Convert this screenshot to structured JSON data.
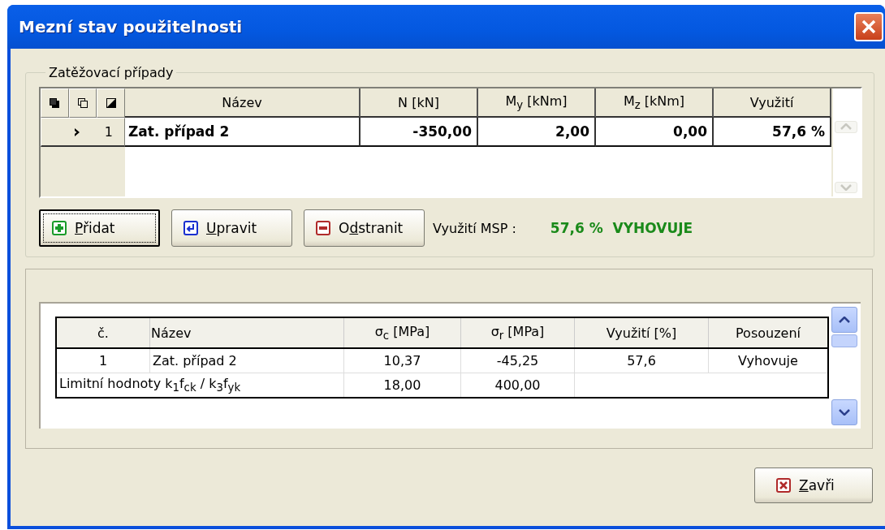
{
  "window": {
    "title": "Mezní stav použitelnosti"
  },
  "load_cases": {
    "title": "Zatěžovací případy",
    "columns": [
      "Název",
      "N [kN]",
      "M$_{y}$ [kNm]",
      "M$_{z}$ [kNm]",
      "Využití"
    ],
    "rows": [
      {
        "number": "1",
        "current": true,
        "cells": [
          "Zat. případ 2",
          "-350,00",
          "2,00",
          "0,00",
          "57,6 %"
        ]
      }
    ]
  },
  "buttons": [
    {
      "key": "P",
      "after": "řidat",
      "kind": "add",
      "focused": true
    },
    {
      "key": "U",
      "after": "pravit",
      "kind": "edit",
      "focused": false
    },
    {
      "before": "O",
      "key": "d",
      "after": "stranit",
      "kind": "remove",
      "focused": false
    }
  ],
  "summary": {
    "label": "Využití MSP :",
    "value": "57,6 %  VYHOVUJE",
    "passed": true
  },
  "results": {
    "columns": [
      "č.",
      "Název",
      "σ$_{c}$ [MPa]",
      "σ$_{r}$ [MPa]",
      "Využití [%]",
      "Posouzení"
    ],
    "rows": [
      {
        "cells": [
          "1",
          "Zat. případ 2",
          "10,37",
          "-45,25",
          "57,6",
          "Vyhovuje"
        ]
      }
    ],
    "limits": {
      "label": "Limitní hodnoty k$_{1}$f$_{ck}$ / k$_{3}$f$_{yk}$",
      "values": [
        "18,00",
        "400,00"
      ]
    }
  },
  "close_button": {
    "key": "Z",
    "after": "avři"
  }
}
